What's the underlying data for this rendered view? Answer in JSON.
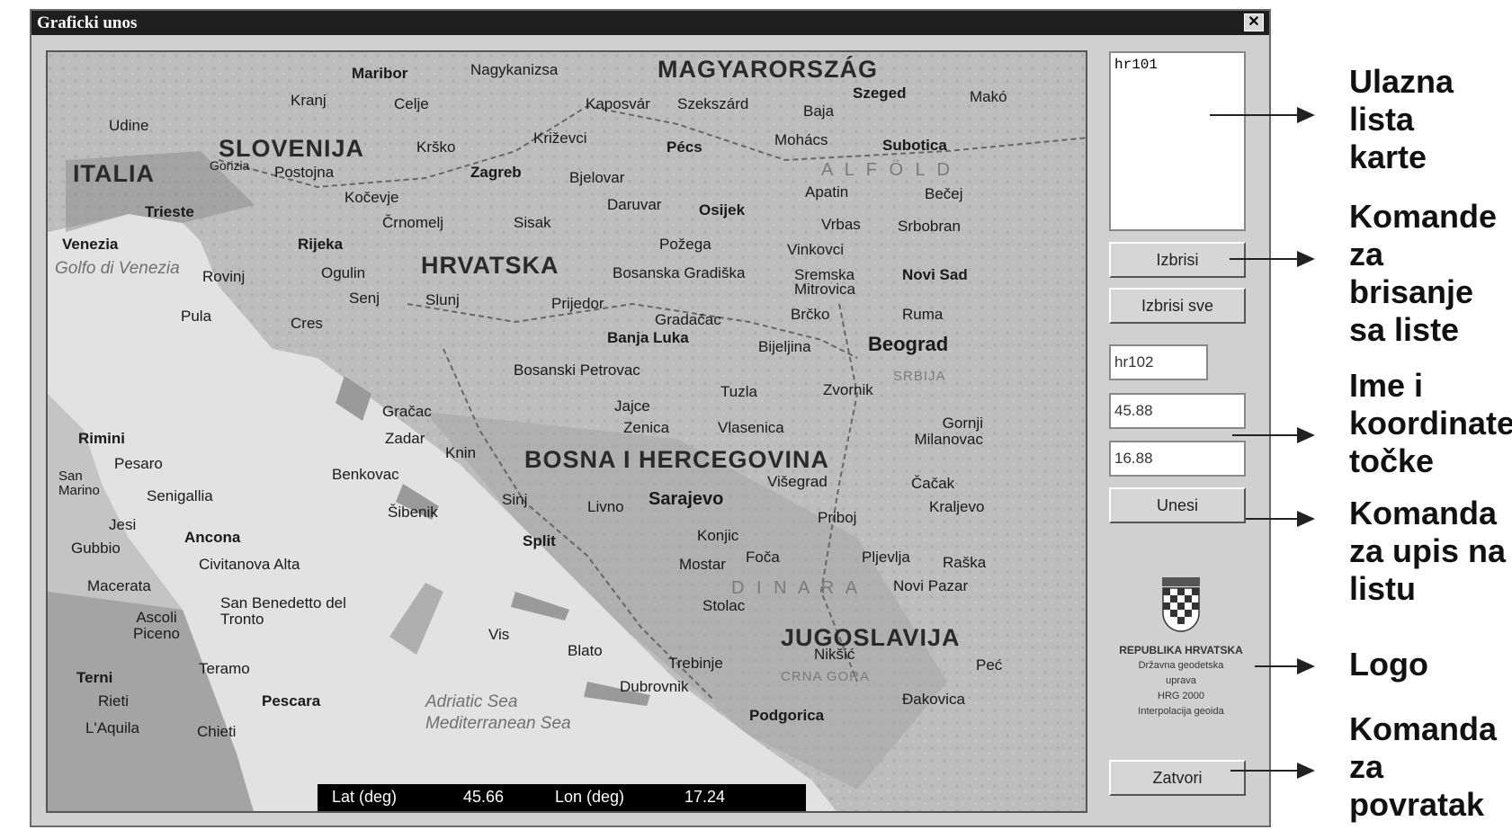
{
  "window": {
    "title": "Graficki unos",
    "close_label": "✕"
  },
  "map": {
    "labels": {
      "magyarorszag": "MAGYARORSZÁG",
      "slovenija": "SLOVENIJA",
      "italia": "ITALIA",
      "hrvatska": "HRVATSKA",
      "bih": "BOSNA I HERCEGOVINA",
      "jugoslavija": "JUGOSLAVIJA",
      "alfold": "A L F Ö L D",
      "dinara": "D I N A R A",
      "srbija": "SRBIJA",
      "crna_gora": "CRNA GORA",
      "golfo": "Golfo di Venezia",
      "adriatic": "Adriatic Sea",
      "mediterranean": "Mediterranean Sea",
      "maribor": "Maribor",
      "nagykanizsa": "Nagykanizsa",
      "kaposvar": "Kaposvár",
      "szekszard": "Szekszárd",
      "szeged": "Szeged",
      "mako": "Makó",
      "baja": "Baja",
      "mohacs": "Mohács",
      "subotica": "Subotica",
      "celje": "Celje",
      "kranj": "Kranj",
      "udine": "Udine",
      "krsko": "Krško",
      "krizevci": "Križevci",
      "pecs": "Pécs",
      "zagreb": "Zagreb",
      "bjelovar": "Bjelovar",
      "gorizia": "Gorizia",
      "postojna": "Postojna",
      "trieste": "Trieste",
      "kocevje": "Kočevje",
      "daruvar": "Daruvar",
      "osijek": "Osijek",
      "apatin": "Apatin",
      "becej": "Bečej",
      "vrbas": "Vrbas",
      "srbobran": "Srbobran",
      "venezia": "Venezia",
      "rijeka": "Rijeka",
      "crnomelj": "Črnomelj",
      "sisak": "Sisak",
      "pozega": "Požega",
      "vinkovci": "Vinkovci",
      "novi_sad": "Novi Sad",
      "rovinj": "Rovinj",
      "ogulin": "Ogulin",
      "bos_gradiska": "Bosanska Gradiška",
      "sremska": "Sremska Mitrovica",
      "senj": "Senj",
      "slunj": "Slunj",
      "prijedor": "Prijedor",
      "brcko": "Brčko",
      "ruma": "Ruma",
      "pula": "Pula",
      "cres": "Cres",
      "gradacac": "Gradačac",
      "banja_luka": "Banja Luka",
      "bijeljina": "Bijeljina",
      "beograd": "Beograd",
      "bos_petrovac": "Bosanski Petrovac",
      "tuzla": "Tuzla",
      "zvornik": "Zvornik",
      "gracac": "Gračac",
      "jajce": "Jajce",
      "zenica": "Zenica",
      "vlasenica": "Vlasenica",
      "gornji_milanovac": "Gornji Milanovac",
      "rimini": "Rimini",
      "zadar": "Zadar",
      "pesaro": "Pesaro",
      "knin": "Knin",
      "san_marino": "San Marino",
      "benkovac": "Benkovac",
      "cacak": "Čačak",
      "senigallia": "Senigallia",
      "sibenik": "Šibenik",
      "sinj": "Sinj",
      "livno": "Livno",
      "sarajevo": "Sarajevo",
      "visegrad": "Višegrad",
      "kraljevo": "Kraljevo",
      "jesi": "Jesi",
      "ancona": "Ancona",
      "split": "Split",
      "konjic": "Konjic",
      "priboj": "Priboj",
      "gubbio": "Gubbio",
      "civitanova": "Civitanova Alta",
      "mostar": "Mostar",
      "foca": "Foča",
      "pljevlja": "Pljevlja",
      "raska": "Raška",
      "macerata": "Macerata",
      "novi_pazar": "Novi Pazar",
      "san_benedetto": "San Benedetto del Tronto",
      "stolac": "Stolac",
      "ascoli": "Ascoli Piceno",
      "vis": "Vis",
      "blato": "Blato",
      "niksic": "Nikšić",
      "terni": "Terni",
      "teramo": "Teramo",
      "trebinje": "Trebinje",
      "pec": "Peć",
      "rieti": "Rieti",
      "pescara": "Pescara",
      "dubrovnik": "Dubrovnik",
      "podgorica": "Podgorica",
      "djakovica": "Đakovica",
      "laquila": "L'Aquila",
      "chieti": "Chieti"
    },
    "status": {
      "lat_label": "Lat (deg)",
      "lat_value": "45.66",
      "lon_label": "Lon (deg)",
      "lon_value": "17.24"
    }
  },
  "panel": {
    "list_items": [
      "hr101"
    ],
    "delete_label": "Izbrisi",
    "delete_all_label": "Izbrisi sve",
    "point_name": "hr102",
    "lat_input": "45.88",
    "lon_input": "16.88",
    "enter_label": "Unesi",
    "close_label": "Zatvori",
    "logo": {
      "org": "REPUBLIKA HRVATSKA",
      "line1": "Državna geodetska",
      "line2": "uprava",
      "line3": "HRG 2000",
      "line4": "Interpolacija geoida"
    }
  },
  "annotations": {
    "input_list": [
      "Ulazna",
      "lista",
      "karte"
    ],
    "delete_commands": [
      "Komande",
      "za",
      "brisanje",
      "sa liste"
    ],
    "name_coords": [
      "Ime i",
      "koordinate",
      "točke"
    ],
    "enter_command": [
      "Komanda",
      "za upis na",
      "listu"
    ],
    "logo": [
      "Logo"
    ],
    "return_command": [
      "Komanda",
      "za",
      "povratak"
    ]
  },
  "colors": {
    "window_bg": "#d0d0d0",
    "titlebar": "#1e1e1e",
    "map_land": "#bdbdbd",
    "map_sea": "#e2e2e2",
    "status_bg": "#000000"
  }
}
